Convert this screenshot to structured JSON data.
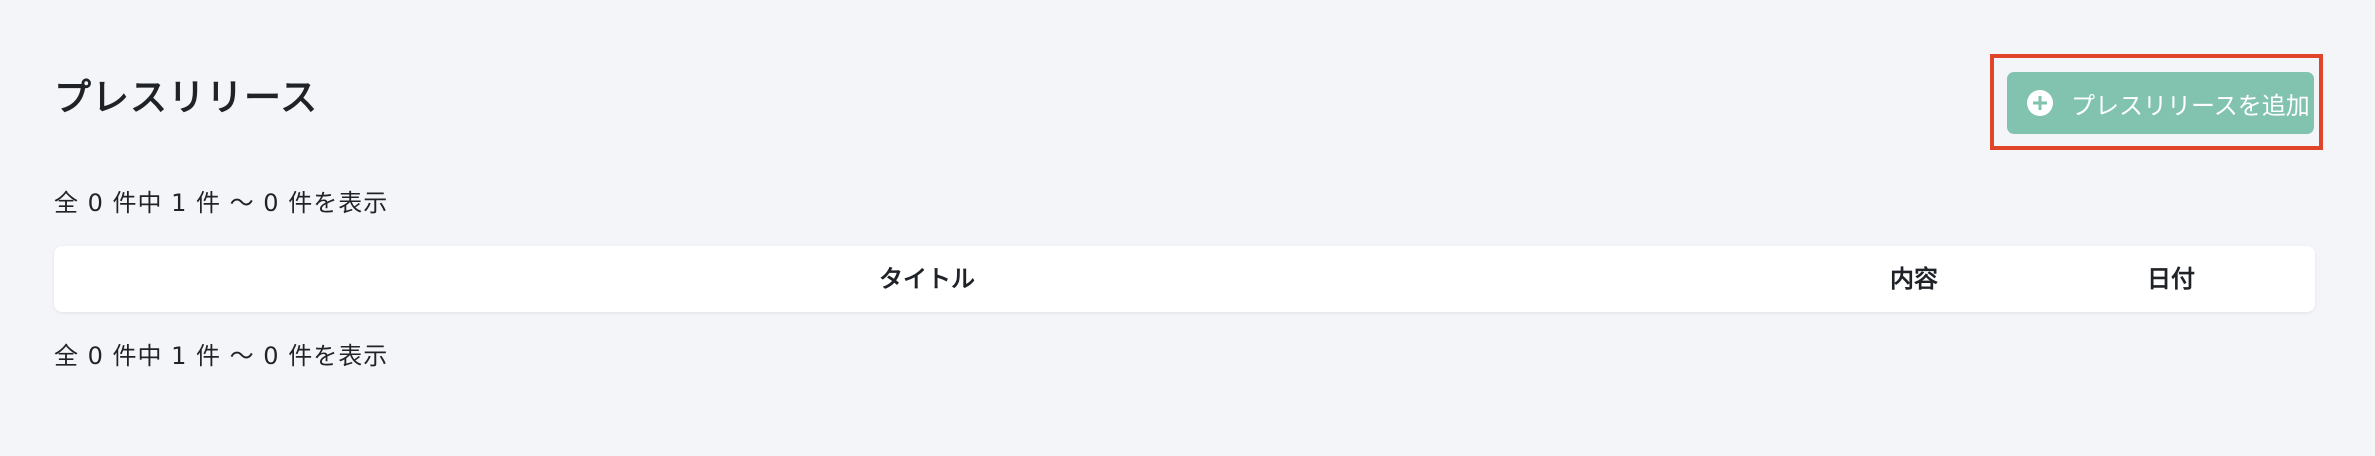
{
  "page": {
    "title": "プレスリリース"
  },
  "actions": {
    "add_label": "プレスリリースを追加",
    "add_icon": "plus-circle-icon"
  },
  "pagination": {
    "summary_top": "全 0 件中 1 件 〜 0 件を表示",
    "summary_bottom": "全 0 件中 1 件 〜 0 件を表示"
  },
  "table": {
    "columns": [
      "タイトル",
      "内容",
      "日付"
    ]
  },
  "colors": {
    "accent": "#82c3af",
    "highlight": "#e0452a",
    "background": "#f4f5f8"
  }
}
